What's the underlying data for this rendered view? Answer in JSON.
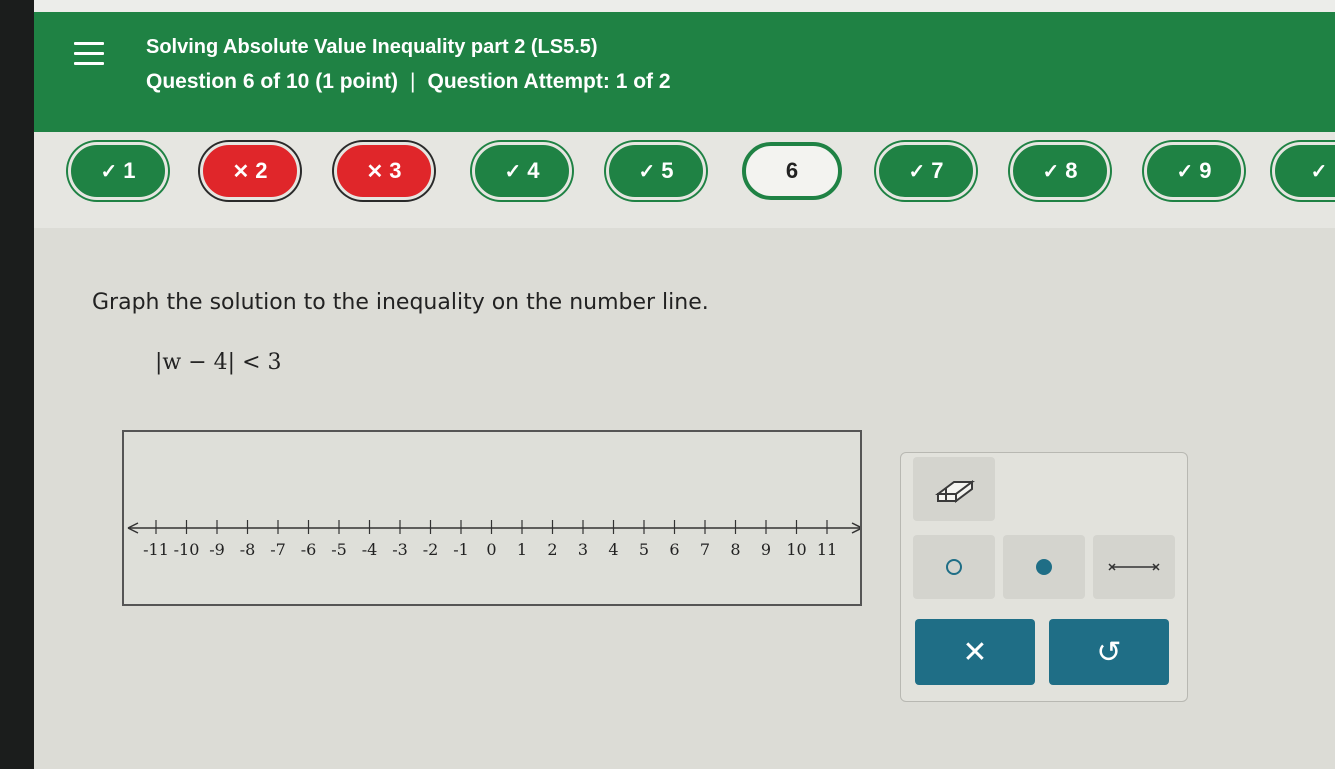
{
  "header": {
    "title": "Solving Absolute Value Inequality part 2 (LS5.5)",
    "question_info": "Question 6 of 10 (1 point)",
    "separator": "|",
    "attempt": "Question Attempt: 1 of 2"
  },
  "question_nav": {
    "items": [
      {
        "label": "1",
        "status": "correct",
        "mark": "✓"
      },
      {
        "label": "2",
        "status": "incorrect",
        "mark": "✕"
      },
      {
        "label": "3",
        "status": "incorrect",
        "mark": "✕"
      },
      {
        "label": "4",
        "status": "correct",
        "mark": "✓"
      },
      {
        "label": "5",
        "status": "correct",
        "mark": "✓"
      },
      {
        "label": "6",
        "status": "current",
        "mark": ""
      },
      {
        "label": "7",
        "status": "correct",
        "mark": "✓"
      },
      {
        "label": "8",
        "status": "correct",
        "mark": "✓"
      },
      {
        "label": "9",
        "status": "correct",
        "mark": "✓"
      },
      {
        "label": "",
        "status": "correct",
        "mark": "✓"
      }
    ]
  },
  "problem": {
    "prompt": "Graph the solution to the inequality on the number line.",
    "inequality": "|w − 4| < 3"
  },
  "number_line": {
    "ticks": [
      "-11",
      "-10",
      "-9",
      "-8",
      "-7",
      "-6",
      "-5",
      "-4",
      "-3",
      "-2",
      "-1",
      "0",
      "1",
      "2",
      "3",
      "4",
      "5",
      "6",
      "7",
      "8",
      "9",
      "10",
      "11"
    ]
  },
  "tools": {
    "eraser_icon": "eraser-icon",
    "open_dot_icon": "open-circle-icon",
    "closed_dot_icon": "closed-circle-icon",
    "segment_icon": "segment-tool-icon",
    "clear_icon": "✕",
    "undo_icon": "↺"
  },
  "colors": {
    "header_green": "#1f8244",
    "wrong_red": "#e0262a",
    "action_teal": "#1f6e86",
    "dot_teal": "#1f6e86"
  }
}
